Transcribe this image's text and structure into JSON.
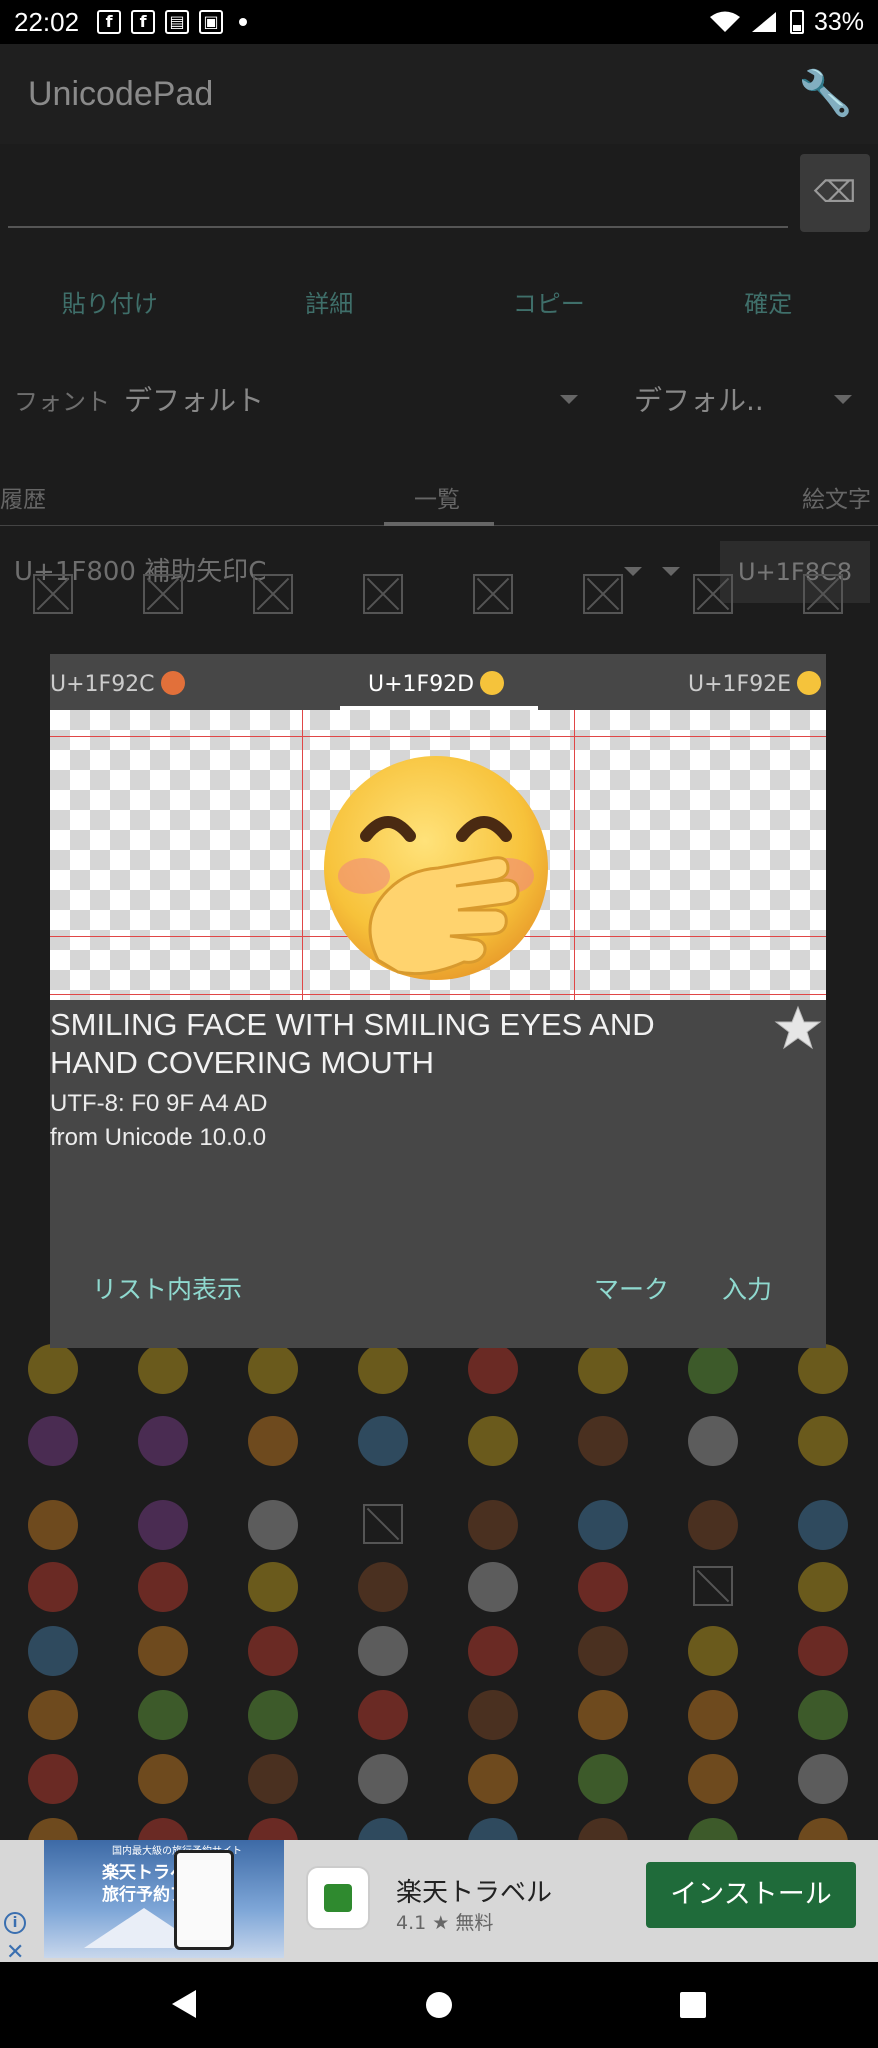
{
  "status_bar": {
    "time": "22:02",
    "battery": "33%"
  },
  "app": {
    "title": "UnicodePad",
    "actions": [
      "貼り付け",
      "詳細",
      "コピー",
      "確定"
    ],
    "font_label": "フォント",
    "font_value": "デフォルト",
    "font_value2": "デフォル..",
    "tabs": {
      "history": "履歴",
      "list": "一覧",
      "emoji": "絵文字"
    },
    "block_name": "U+1F800 補助矢印C",
    "block_button": "U+1F8C8"
  },
  "dialog": {
    "tab_prev": "U+1F92C",
    "tab_current": "U+1F92D",
    "tab_next": "U+1F92E",
    "char_name": "SMILING FACE WITH SMILING EYES AND HAND COVERING MOUTH",
    "utf8": "UTF-8: F0 9F A4 AD",
    "version": "from Unicode 10.0.0",
    "show_in_list": "リスト内表示",
    "mark": "マーク",
    "input": "入力"
  },
  "ad": {
    "image_line0": "国内最大級の旅行予約サイト",
    "image_line1": "楽天トラベル",
    "image_line2": "旅行予約アプリ",
    "app_title": "楽天トラベル",
    "rating": "4.1 ★ 無料",
    "install": "インストール"
  },
  "colors": {
    "accent": "#8fd9cf",
    "dialog_bg": "#474747",
    "guide_line": "#e04646",
    "install_bg": "#1f6b3a"
  }
}
